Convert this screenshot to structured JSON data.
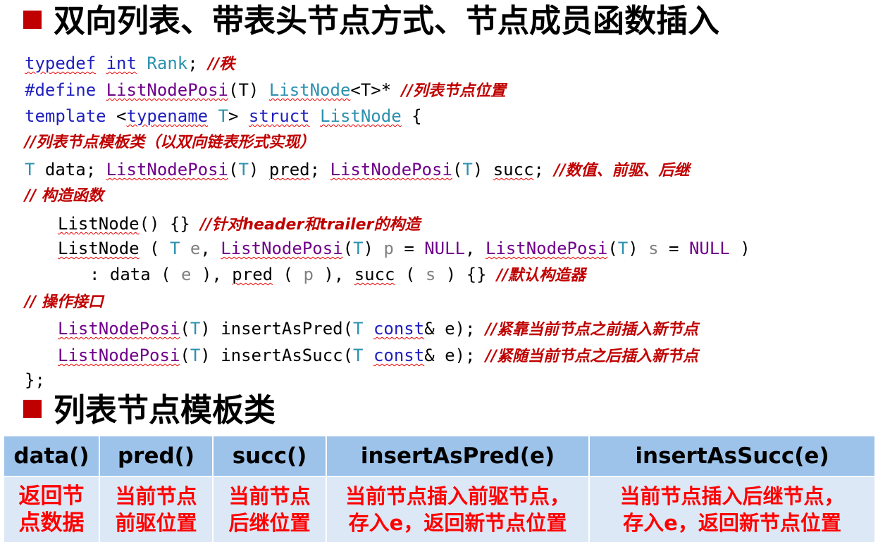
{
  "title": "双向列表、带表头节点方式、节点成员函数插入",
  "subtitle": "列表节点模板类",
  "code": {
    "l1": {
      "t1": "typedef",
      "t2": "int",
      "t3": "Rank",
      "t4": ";",
      "c": "//秩"
    },
    "l2": {
      "t1": "#define",
      "t2": "ListNodePosi",
      "t3": "(T)",
      "t4": "ListNode",
      "t5": "<T>*",
      "c": "//列表节点位置"
    },
    "l3": {
      "t1": "template",
      "t2": "<",
      "t3": "typename",
      "t4": "T",
      "t5": ">",
      "t6": "struct",
      "t7": "ListNode",
      "t8": "{"
    },
    "l4": {
      "c": "//列表节点模板类（以双向链表形式实现）"
    },
    "l5": {
      "t1": "T",
      "t2": " data; ",
      "t3": "ListNodePosi",
      "t4": "(",
      "t5": "T",
      "t6": ") ",
      "t7": "pred",
      "t8": "; ",
      "t9": "ListNodePosi",
      "t10": "(",
      "t11": "T",
      "t12": ") ",
      "t13": "succ",
      "t14": "; ",
      "c": "//数值、前驱、后继"
    },
    "l6": {
      "c": "// 构造函数"
    },
    "l7": {
      "t1": "ListNode",
      "t2": "() {} ",
      "c": "//针对header和trailer的构造"
    },
    "l8": {
      "t1": "ListNode",
      "t2": " ( ",
      "t3": "T",
      "t4": "e",
      "t5": ", ",
      "t6": "ListNodePosi",
      "t7": "(",
      "t8": "T",
      "t9": ") ",
      "t10": "p",
      "t11": " = ",
      "t12": "NULL",
      "t13": ", ",
      "t14": "ListNodePosi",
      "t15": "(",
      "t16": "T",
      "t17": ") ",
      "t18": "s",
      "t19": " = ",
      "t20": "NULL",
      "t21": " )"
    },
    "l9": {
      "t1": ": data ( ",
      "t2": "e",
      "t3": " ), ",
      "t4": "pred",
      "t5": " ( ",
      "t6": "p",
      "t7": " ), ",
      "t8": "succ",
      "t9": " ( ",
      "t10": "s",
      "t11": " ) {} ",
      "c": "//默认构造器"
    },
    "l10": {
      "c": "// 操作接口"
    },
    "l11": {
      "t1": "ListNodePosi",
      "t2": "(",
      "t3": "T",
      "t4": ") insertAsPred(",
      "t5": "T",
      "t6": " ",
      "t7": "const",
      "t8": "& e); ",
      "c": "//紧靠当前节点之前插入新节点"
    },
    "l12": {
      "t1": "ListNodePosi",
      "t2": "(",
      "t3": "T",
      "t4": ") insertAsSucc(",
      "t5": "T",
      "t6": " ",
      "t7": "const",
      "t8": "& e); ",
      "c": "//紧随当前节点之后插入新节点"
    },
    "l13": {
      "t1": "};"
    }
  },
  "table": {
    "headers": [
      "data()",
      "pred()",
      "succ()",
      "insertAsPred(e)",
      "insertAsSucc(e)"
    ],
    "rows": [
      [
        "返回节",
        "当前节点",
        "当前节点",
        "当前节点插入前驱节点，",
        "当前节点插入后继节点，"
      ],
      [
        "点数据",
        "前驱位置",
        "后继位置",
        "存入e，返回新节点位置",
        "存入e，返回新节点位置"
      ]
    ]
  },
  "colors": {
    "accent": "#c00000",
    "header_bg": "#9dc3ea",
    "body_bg": "#dce8f6"
  }
}
